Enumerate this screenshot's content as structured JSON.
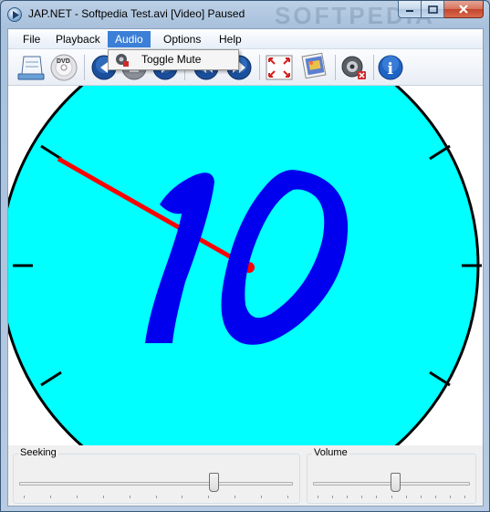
{
  "window": {
    "title": "JAP.NET - Softpedia Test.avi [Video] Paused",
    "watermark": "SOFTPEDIA",
    "controls": {
      "minimize": "minimize",
      "maximize": "maximize",
      "close": "close"
    }
  },
  "menu": {
    "items": [
      {
        "label": "File",
        "active": false
      },
      {
        "label": "Playback",
        "active": false
      },
      {
        "label": "Audio",
        "active": true
      },
      {
        "label": "Options",
        "active": false
      },
      {
        "label": "Help",
        "active": false
      }
    ],
    "dropdown": {
      "items": [
        {
          "label": "Toggle Mute",
          "icon": "mute-speaker-icon"
        }
      ]
    }
  },
  "toolbar": {
    "buttons": [
      {
        "name": "open-file-button",
        "icon": "open-file-icon"
      },
      {
        "name": "open-dvd-button",
        "icon": "dvd-icon",
        "text": "DVD"
      },
      {
        "name": "previous-button",
        "icon": "previous-icon"
      },
      {
        "name": "stop-button",
        "icon": "stop-icon"
      },
      {
        "name": "next-chapter-button",
        "icon": "next-chapter-icon"
      },
      {
        "name": "rewind-button",
        "icon": "rewind-icon"
      },
      {
        "name": "fast-forward-button",
        "icon": "fast-forward-icon"
      },
      {
        "name": "fullscreen-button",
        "icon": "fullscreen-icon"
      },
      {
        "name": "snapshot-button",
        "icon": "snapshot-icon"
      },
      {
        "name": "mute-button",
        "icon": "speaker-mute-icon"
      },
      {
        "name": "about-button",
        "icon": "info-icon",
        "text": "i"
      }
    ]
  },
  "video": {
    "frame_text": "10",
    "colors": {
      "dial": "#00ffff",
      "digits": "#0000ee",
      "hand": "#ff0000",
      "tick": "#000000"
    }
  },
  "seeking": {
    "label": "Seeking",
    "position": 0.72
  },
  "volume": {
    "label": "Volume",
    "level": 0.53
  },
  "colors": {
    "menu_highlight": "#3b7fd6",
    "close_button": "#c4452b",
    "frame_border": "#3b5878"
  }
}
